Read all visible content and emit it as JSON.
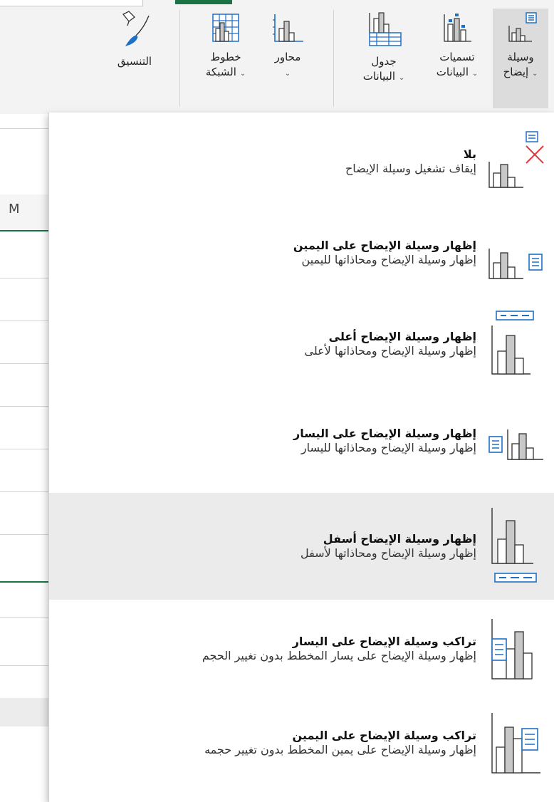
{
  "ribbon": {
    "buttons": [
      {
        "id": "legend",
        "line1": "وسيلة",
        "line2": "إيضاح",
        "icon": "chart-legend-icon"
      },
      {
        "id": "data-labels",
        "line1": "تسميات",
        "line2": "البيانات",
        "icon": "data-labels-icon"
      },
      {
        "id": "data-table",
        "line1": "جدول",
        "line2": "البيانات",
        "icon": "data-table-icon"
      },
      {
        "id": "axes",
        "line1": "محاور",
        "line2": "",
        "icon": "axes-icon"
      },
      {
        "id": "gridlines",
        "line1": "خطوط",
        "line2": "الشبكة",
        "icon": "gridlines-icon"
      },
      {
        "id": "format",
        "line1": "التنسيق",
        "line2": "",
        "icon": "format-brush-icon"
      }
    ],
    "chevron": "⌄",
    "accent_color": "#1a7343"
  },
  "grid": {
    "column_header": "M"
  },
  "menu": {
    "items": [
      {
        "title": "بلا",
        "desc": "إيقاف تشغيل وسيلة الإيضاح",
        "icon": "legend-none-icon"
      },
      {
        "title": "إظهار وسيلة الإيضاح على اليمين",
        "desc": "إظهار وسيلة الإيضاح ومحاذاتها لليمين",
        "icon": "legend-right-icon"
      },
      {
        "title": "إظهار وسيلة الإيضاح أعلى",
        "desc": "إظهار وسيلة الإيضاح ومحاذاتها لأعلى",
        "icon": "legend-top-icon"
      },
      {
        "title": "إظهار وسيلة الإيضاح على اليسار",
        "desc": "إظهار وسيلة الإيضاح ومحاذاتها لليسار",
        "icon": "legend-left-icon"
      },
      {
        "title": "إظهار وسيلة الإيضاح أسفل",
        "desc": "إظهار وسيلة الإيضاح ومحاذاتها لأسفل",
        "icon": "legend-bottom-icon",
        "selected": true
      },
      {
        "title": "تراكب وسيلة الإيضاح على اليسار",
        "desc": "إظهار وسيلة الإيضاح على يسار المخطط بدون تغيير الحجم",
        "icon": "legend-overlay-left-icon"
      },
      {
        "title": "تراكب وسيلة الإيضاح على اليمين",
        "desc": "إظهار وسيلة الإيضاح على يمين المخطط بدون تغيير حجمه",
        "icon": "legend-overlay-right-icon"
      }
    ],
    "colors": {
      "blue": "#1f6fc5",
      "red": "#e0383e",
      "bar_gray": "#c8c8c8",
      "stroke": "#333333",
      "selected_bg": "#ebebeb"
    }
  }
}
